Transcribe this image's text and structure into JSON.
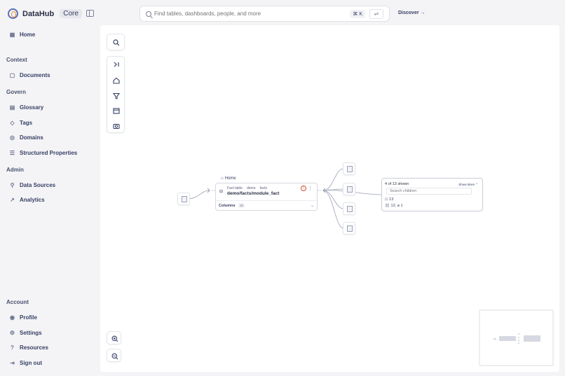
{
  "header": {
    "brand": "DataHub",
    "badge": "Core",
    "search_placeholder": "Find tables, dashboards, people, and more",
    "shortcut": "⌘ K",
    "discover": "Discover →"
  },
  "sidebar": {
    "home": "Home",
    "sections": {
      "context": "Context",
      "govern": "Govern",
      "admin": "Admin",
      "account": "Account"
    },
    "context_items": [
      "Documents"
    ],
    "govern_items": [
      "Glossary",
      "Tags",
      "Domains",
      "Structured Properties"
    ],
    "admin_items": [
      "Data Sources",
      "Analytics"
    ],
    "account_items": [
      "Profile",
      "Settings",
      "Resources",
      "Sign out"
    ]
  },
  "lineage": {
    "node": {
      "breadcrumb": "Home",
      "type": "Fact table",
      "tag1": "demo",
      "tag2": "facts",
      "name": "demo/facts/module_fact",
      "columns_label": "Columns",
      "columns_count": "35"
    },
    "group": {
      "title": "4 of 13 shown",
      "show_more": "Show More ⌃",
      "search_placeholder": "Search children",
      "stat_total": "13",
      "stat_split": "12, ⌀ 1"
    }
  }
}
